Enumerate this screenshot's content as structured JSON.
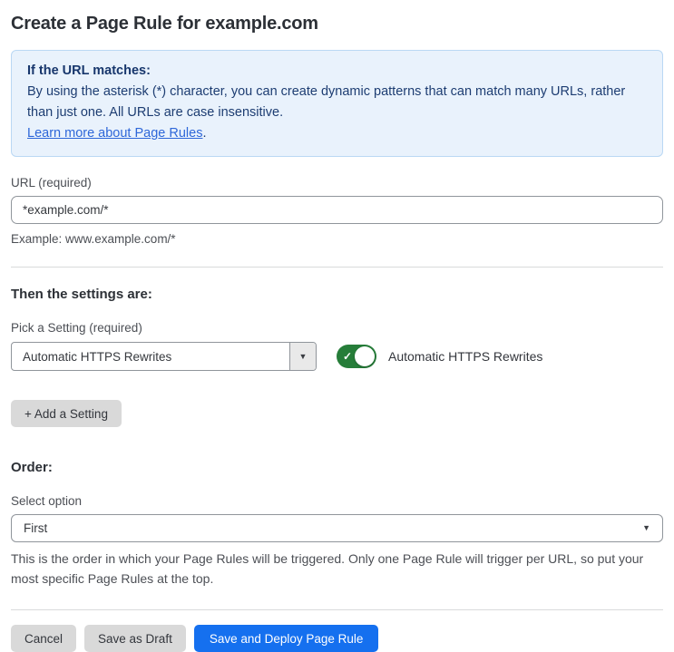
{
  "page": {
    "title": "Create a Page Rule for example.com"
  },
  "info_box": {
    "heading": "If the URL matches:",
    "body": "By using the asterisk (*) character, you can create dynamic patterns that can match many URLs, rather than just one. All URLs are case insensitive.",
    "link_label": "Learn more about Page Rules",
    "link_suffix": "."
  },
  "url_field": {
    "label": "URL (required)",
    "value": "*example.com/*",
    "helper": "Example: www.example.com/*"
  },
  "settings_section": {
    "heading": "Then the settings are:",
    "picker_label": "Pick a Setting (required)",
    "picker_value": "Automatic HTTPS Rewrites",
    "toggle_state": "on",
    "toggle_label": "Automatic HTTPS Rewrites",
    "add_setting_label": "+ Add a Setting"
  },
  "order_section": {
    "heading": "Order:",
    "select_label": "Select option",
    "select_value": "First",
    "helper": "This is the order in which your Page Rules will be triggered. Only one Page Rule will trigger per URL, so put your most specific Page Rules at the top."
  },
  "actions": {
    "cancel": "Cancel",
    "save_draft": "Save as Draft",
    "save_deploy": "Save and Deploy Page Rule"
  },
  "icons": {
    "chevron_down": "▼",
    "check": "✓"
  },
  "colors": {
    "accent_blue": "#1570ef",
    "toggle_green": "#267d39",
    "info_bg": "#e9f2fc",
    "info_border": "#bad8f4",
    "info_text": "#1d3d72",
    "link_blue": "#2e67d9",
    "button_gray": "#d9d9d9"
  }
}
